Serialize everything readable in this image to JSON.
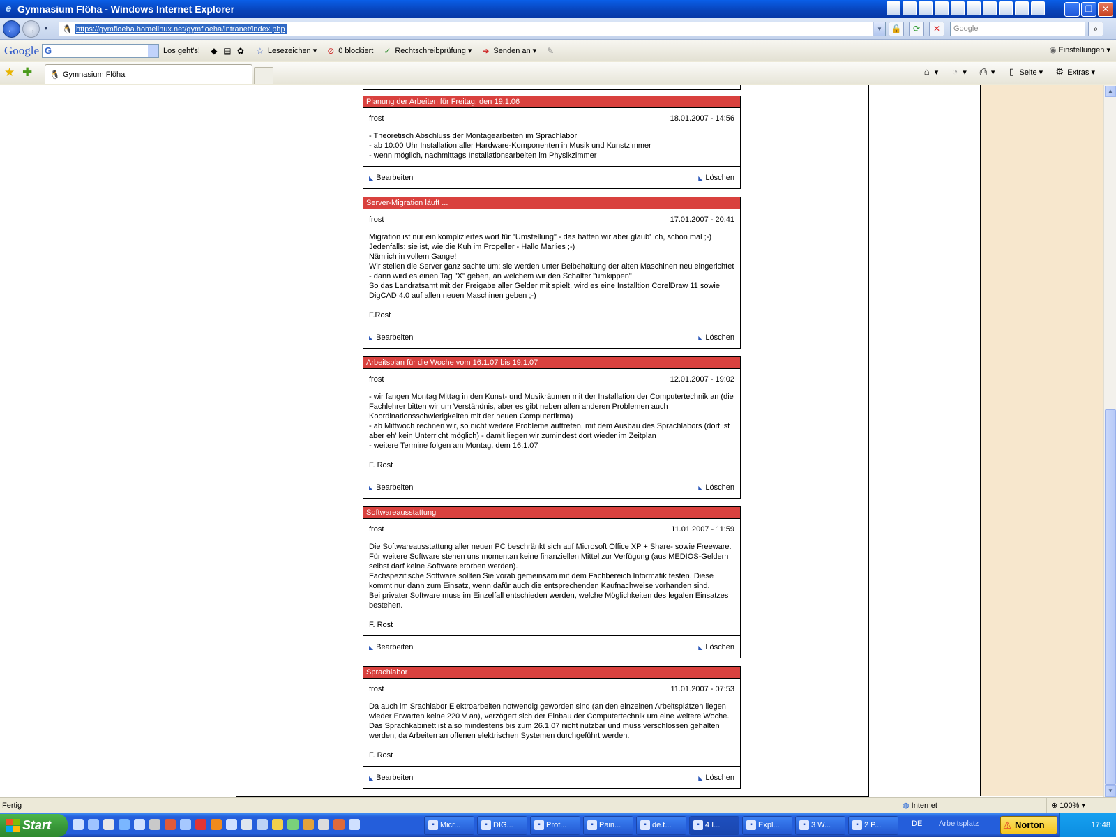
{
  "window": {
    "title": "Gymnasium Flöha - Windows Internet Explorer"
  },
  "address": {
    "url": "https://gymfloeha.homelinux.net/gymfloeha/intranet/index.php",
    "search_placeholder": "Google"
  },
  "google_toolbar": {
    "logo": "Google",
    "go_label": "Los geht's!",
    "bookmarks_label": "Lesezeichen",
    "blocked_label": "0 blockiert",
    "spellcheck_label": "Rechtschreibprüfung",
    "send_label": "Senden an",
    "settings_label": "Einstellungen"
  },
  "tab": {
    "title": "Gymnasium Flöha"
  },
  "commandbar": {
    "page_label": "Seite",
    "extras_label": "Extras"
  },
  "posts": [
    {
      "title": "Planung der Arbeiten für Freitag, den 19.1.06",
      "author": "frost",
      "date": "18.01.2007 - 14:56",
      "body": "- Theoretisch Abschluss der Montagearbeiten im Sprachlabor\n- ab 10:00 Uhr Installation aller Hardware-Komponenten in Musik und Kunstzimmer\n- wenn möglich, nachmittags Installationsarbeiten im Physikzimmer",
      "edit": "Bearbeiten",
      "delete": "Löschen"
    },
    {
      "title": "Server-Migration läuft ...",
      "author": "frost",
      "date": "17.01.2007 - 20:41",
      "body": "Migration ist nur ein kompliziertes wort für \"Umstellung\" - das hatten wir aber glaub' ich, schon mal ;-)\nJedenfalls: sie ist, wie die Kuh im Propeller - Hallo Marlies ;-)\nNämlich in vollem Gange!\nWir stellen die Server ganz sachte um: sie werden unter Beibehaltung der alten Maschinen neu eingerichtet - dann wird es einen Tag \"X\" geben, an welchem wir den Schalter \"umkippen\"\nSo das Landratsamt mit der Freigabe aller Gelder mit spielt, wird es eine Installtion CorelDraw 11 sowie DigCAD 4.0 auf allen neuen Maschinen geben ;-)\n\nF.Rost",
      "edit": "Bearbeiten",
      "delete": "Löschen"
    },
    {
      "title": "Arbeitsplan für die Woche vom 16.1.07 bis 19.1.07",
      "author": "frost",
      "date": "12.01.2007 - 19:02",
      "body": "- wir fangen Montag Mittag in den Kunst- und Musikräumen mit der Installation der Computertechnik an (die Fachlehrer bitten wir um Verständnis, aber es gibt neben allen anderen Problemen auch Koordinationsschwierigkeiten mit der neuen Computerfirma)\n- ab Mittwoch rechnen wir, so nicht weitere Probleme auftreten, mit dem Ausbau des Sprachlabors (dort ist aber eh' kein Unterricht möglich) - damit liegen wir zumindest dort wieder im Zeitplan\n- weitere Termine folgen am Montag, dem 16.1.07\n\nF. Rost",
      "edit": "Bearbeiten",
      "delete": "Löschen"
    },
    {
      "title": "Softwareausstattung",
      "author": "frost",
      "date": "11.01.2007 - 11:59",
      "body": "Die Softwareausstattung aller neuen PC beschränkt sich auf Microsoft Office XP + Share- sowie Freeware. Für weitere Software stehen uns momentan keine finanziellen Mittel zur Verfügung (aus MEDIOS-Geldern selbst darf keine Software erorben werden).\nFachspezifische Software sollten Sie vorab gemeinsam mit dem Fachbereich Informatik testen. Diese kommt nur dann zum Einsatz, wenn dafür auch die entsprechenden Kaufnachweise vorhanden sind.\nBei privater Software muss im Einzelfall entschieden werden, welche Möglichkeiten des legalen Einsatzes bestehen.\n\nF. Rost",
      "edit": "Bearbeiten",
      "delete": "Löschen"
    },
    {
      "title": "Sprachlabor",
      "author": "frost",
      "date": "11.01.2007 - 07:53",
      "body": "Da auch im Srachlabor Elektroarbeiten notwendig geworden sind (an den einzelnen Arbeitsplätzen liegen wieder Erwarten keine 220 V an), verzögert sich der Einbau der Computertechnik um eine weitere Woche. Das Sprachkabinett ist also mindestens bis zum 26.1.07 nicht nutzbar und muss verschlossen gehalten werden, da Arbeiten an offenen elektrischen Systemen durchgeführt werden.\n\nF. Rost",
      "edit": "Bearbeiten",
      "delete": "Löschen"
    }
  ],
  "statusbar": {
    "text": "Fertig",
    "zone": "Internet",
    "zoom": "100%"
  },
  "taskbar": {
    "start": "Start",
    "tasks": [
      "Micr...",
      "DIG...",
      "Prof...",
      "Pain...",
      "de.t...",
      "4 I...",
      "Expl...",
      "3 W...",
      "2 P..."
    ],
    "lang": "DE",
    "desktop": "Arbeitsplatz",
    "norton": "Norton",
    "clock": "17:48"
  }
}
